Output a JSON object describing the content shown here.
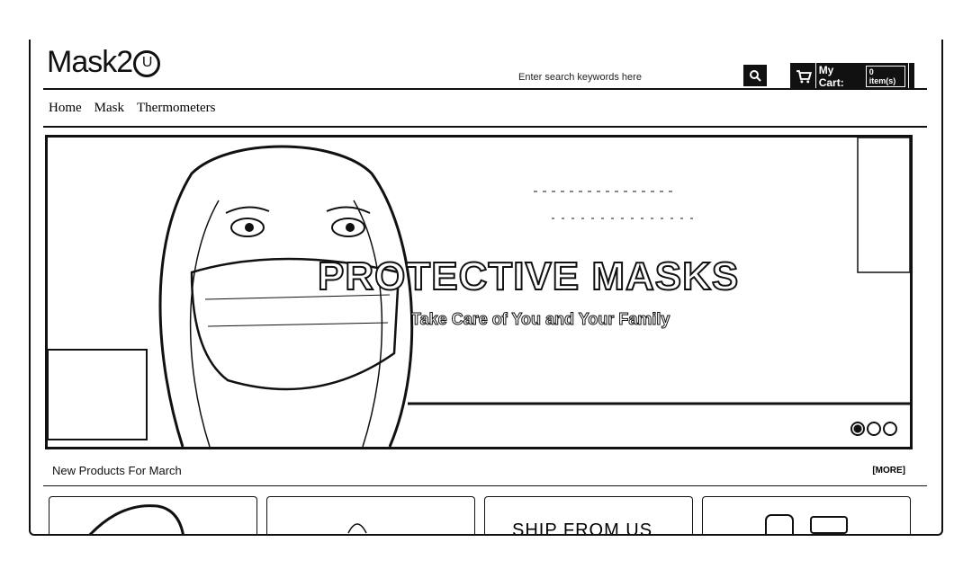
{
  "header": {
    "logo_text": "Mask2",
    "logo_mark": "U",
    "search_placeholder": "Enter search keywords here",
    "search_icon": "search-icon",
    "cart": {
      "label": "My Cart:",
      "count": "0 item(s)",
      "icon": "cart-icon"
    }
  },
  "nav": {
    "items": [
      "Home",
      "Mask",
      "Thermometers"
    ]
  },
  "banner": {
    "title": "PROTECTIVE MASKS",
    "subtitle": "Take Care of You and Your Family",
    "slides": 3,
    "active_slide": 1
  },
  "products": {
    "section_title": "New Products For March",
    "more_label": "[MORE]",
    "card_caption": "SHIP FROM US"
  }
}
